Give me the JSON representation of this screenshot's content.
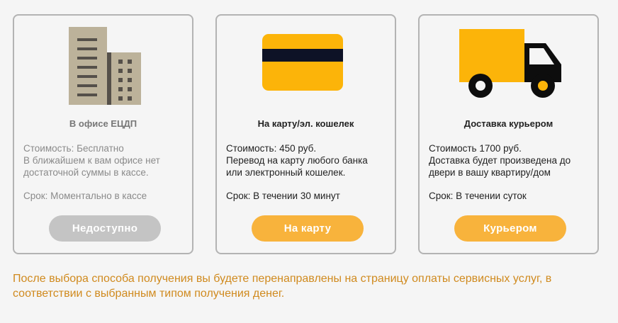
{
  "colors": {
    "accent": "#f8b33c",
    "disabled": "#c4c4c4",
    "note": "#d08a1e",
    "card_border": "#b3b3b3"
  },
  "options": [
    {
      "icon": "office-building-icon",
      "title": "В офисе ЕЦДП",
      "cost_line": "Стоимость: Бесплатно",
      "desc_lines": [
        "В ближайшем к вам офисе нет",
        "достаточной суммы в кассе."
      ],
      "term": "Срок: Моментально в кассе",
      "button_label": "Недоступно",
      "available": false
    },
    {
      "icon": "bank-card-icon",
      "title": "На карту/эл. кошелек",
      "cost_line": "Стоимость: 450 руб.",
      "desc_lines": [
        "Перевод на карту любого банка",
        "или электронный кошелек."
      ],
      "term": "Срок: В течении 30 минут",
      "button_label": "На карту",
      "available": true
    },
    {
      "icon": "delivery-truck-icon",
      "title": "Доставка курьером",
      "cost_line": "Стоимость 1700 руб.",
      "desc_lines": [
        "Доставка будет произведена до",
        "двери в вашу квартиру/дом"
      ],
      "term": "Срок: В течении суток",
      "button_label": "Курьером",
      "available": true
    }
  ],
  "footer_note": "После выбора способа получения вы будете перенаправлены на страницу оплаты сервисных услуг, в соответствии с выбранным типом получения денег."
}
